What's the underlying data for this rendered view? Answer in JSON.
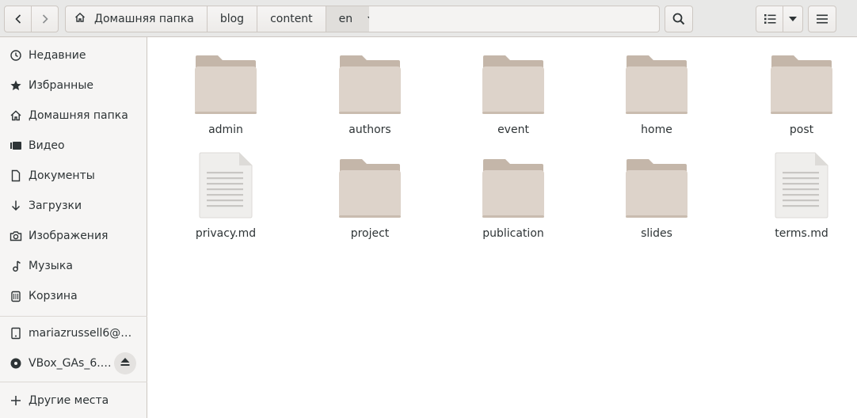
{
  "nav": {
    "back_icon": "chevron-left-icon",
    "forward_icon": "chevron-right-icon"
  },
  "pathbar": {
    "home_label": "Домашняя папка",
    "crumbs": [
      "blog",
      "content"
    ],
    "current": "en"
  },
  "toolbar": {
    "search_icon": "search-icon",
    "view_icon": "list-view-icon",
    "view_menu_icon": "chevron-down-icon",
    "menu_icon": "hamburger-menu-icon"
  },
  "sidebar": {
    "places": [
      {
        "label": "Недавние",
        "icon": "clock-icon"
      },
      {
        "label": "Избранные",
        "icon": "star-icon"
      },
      {
        "label": "Домашняя папка",
        "icon": "home-icon"
      },
      {
        "label": "Видео",
        "icon": "video-icon"
      },
      {
        "label": "Документы",
        "icon": "document-icon"
      },
      {
        "label": "Загрузки",
        "icon": "download-icon"
      },
      {
        "label": "Изображения",
        "icon": "camera-icon"
      },
      {
        "label": "Музыка",
        "icon": "music-icon"
      },
      {
        "label": "Корзина",
        "icon": "trash-icon"
      }
    ],
    "devices": [
      {
        "label": "mariazrussell6@…",
        "icon": "network-drive-icon"
      },
      {
        "label": "VBox_GAs_6.…",
        "icon": "disc-icon"
      }
    ],
    "other": {
      "label": "Другие места",
      "icon": "plus-icon"
    }
  },
  "files": [
    {
      "name": "admin",
      "type": "folder"
    },
    {
      "name": "authors",
      "type": "folder"
    },
    {
      "name": "event",
      "type": "folder"
    },
    {
      "name": "home",
      "type": "folder"
    },
    {
      "name": "post",
      "type": "folder"
    },
    {
      "name": "privacy.md",
      "type": "text"
    },
    {
      "name": "project",
      "type": "folder"
    },
    {
      "name": "publication",
      "type": "folder"
    },
    {
      "name": "slides",
      "type": "folder"
    },
    {
      "name": "terms.md",
      "type": "text"
    }
  ],
  "colors": {
    "folder": "#d2c6bb",
    "folder_tab": "#c4b6a9",
    "headerbar": "#e8e8e7",
    "sidebar": "#f6f5f4"
  }
}
